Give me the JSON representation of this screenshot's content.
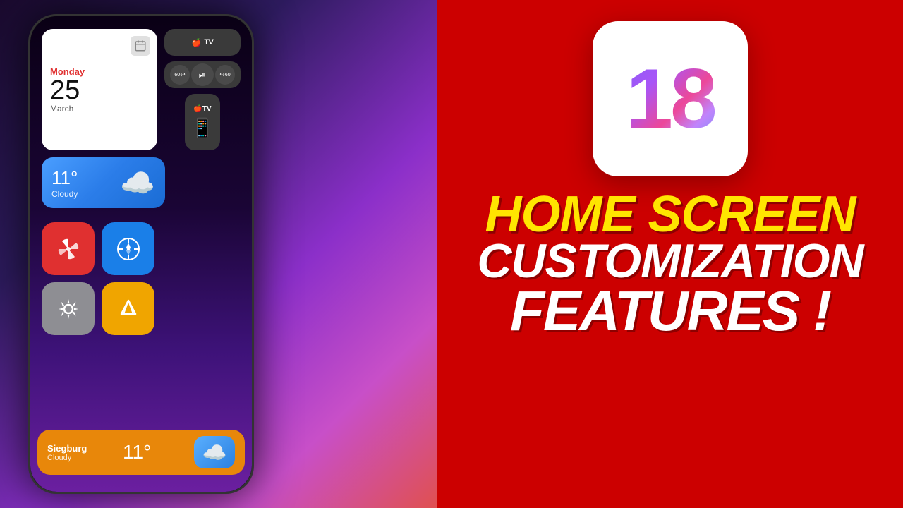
{
  "background": {
    "left_gradient": "purple to pink",
    "right_color": "#cc0000"
  },
  "phone": {
    "date_widget": {
      "day": "Monday",
      "number": "25",
      "month": "March",
      "icon": "📅"
    },
    "weather_widget": {
      "temperature": "11°",
      "description": "Cloudy",
      "icon": "☁️"
    },
    "apps": [
      {
        "name": "Pinwheel",
        "color": "red",
        "icon": "✳"
      },
      {
        "name": "Safari",
        "color": "blue",
        "icon": "🧭"
      },
      {
        "name": "Settings",
        "color": "gray",
        "icon": "⚙"
      },
      {
        "name": "Google Drive",
        "color": "yellow",
        "icon": "△"
      }
    ],
    "bottom_bar": {
      "city": "Siegburg",
      "description": "Cloudy",
      "temperature": "11°",
      "cloud_icon": "☁️"
    },
    "tv_widget": {
      "label": "Apple TV",
      "skip_back": "60",
      "play_pause": "⏯",
      "skip_forward": "60"
    }
  },
  "branding": {
    "ios_version": "18",
    "title_line1": "HOME SCREEN",
    "title_line2": "CUSTOMIZATION",
    "title_line3": "FEATURES !"
  }
}
